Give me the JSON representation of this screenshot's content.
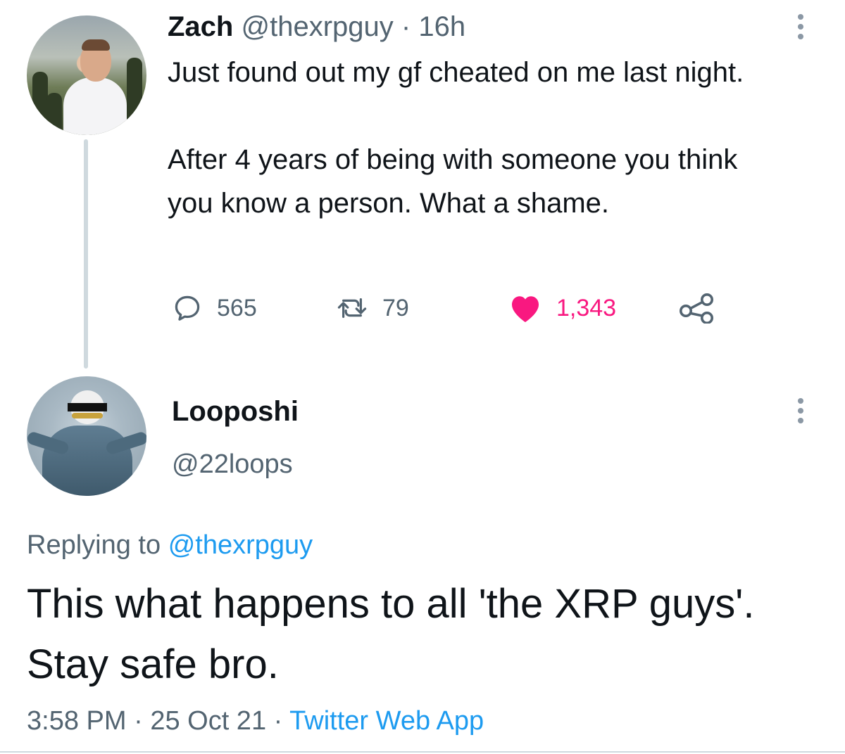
{
  "tweet": {
    "author_name": "Zach",
    "author_handle": "@thexrpguy",
    "separator": "·",
    "time_ago": "16h",
    "text_line_1": "Just found out my gf cheated on me last night.",
    "text_line_2": "After 4 years of being with someone you think you know a person. What a shame.",
    "replies": "565",
    "retweets": "79",
    "likes": "1,343",
    "liked": true,
    "icons": [
      "reply-icon",
      "retweet-icon",
      "heart-icon",
      "share-icon",
      "more-icon"
    ],
    "like_color": "#f91880"
  },
  "reply": {
    "author_name": "Looposhi",
    "author_handle": "@22loops",
    "replying_prefix": "Replying to",
    "replying_to": "@thexrpguy",
    "text": "This what happens to all 'the XRP guys'. Stay safe bro.",
    "time": "3:58 PM",
    "separator": "·",
    "date": "25 Oct 21",
    "source": "Twitter Web App"
  },
  "colors": {
    "text": "#0f1419",
    "secondary": "#536471",
    "link": "#1d9bf0",
    "thread_line": "#cfd9de"
  }
}
